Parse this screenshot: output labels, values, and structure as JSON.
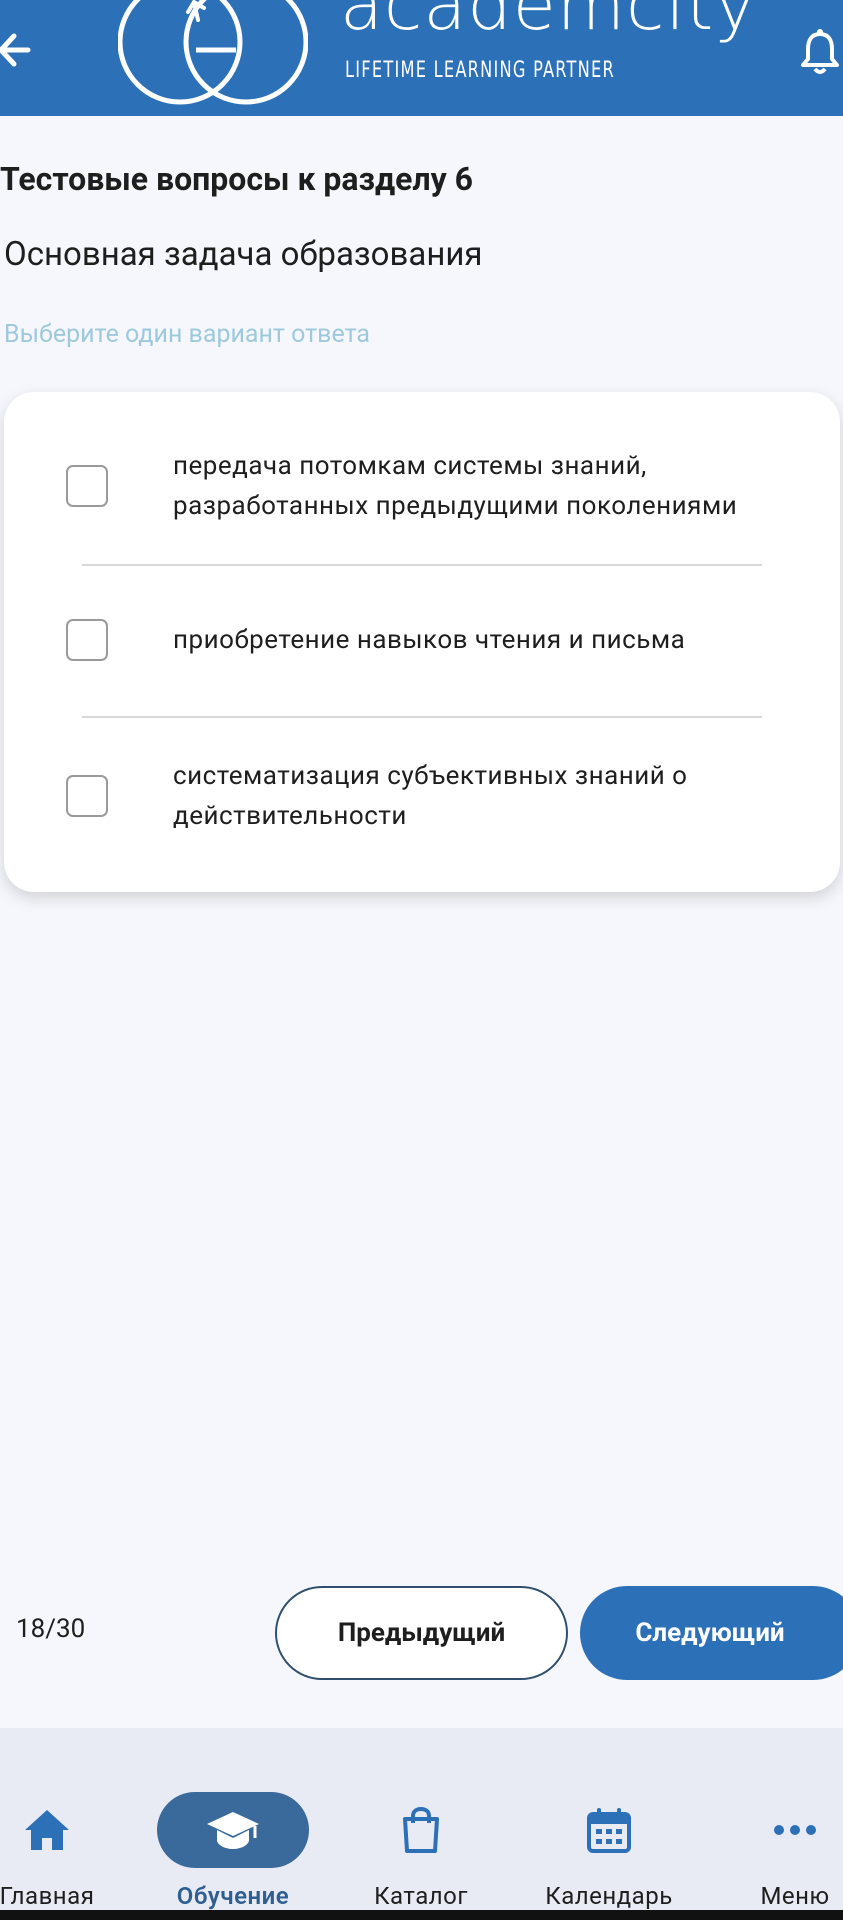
{
  "header": {
    "brand_name": "academcity",
    "brand_tagline": "LIFETIME LEARNING PARTNER"
  },
  "section_title": "Тестовые вопросы к разделу 6",
  "question": "Основная задача образования",
  "hint": "Выберите один вариант ответа",
  "options": [
    {
      "label": "передача потомкам системы знаний, разработанных предыдущими поколениями",
      "checked": false
    },
    {
      "label": "приобретение навыков чтения и письма",
      "checked": false
    },
    {
      "label": "систематизация субъективных знаний о действительности",
      "checked": false
    }
  ],
  "pagination": {
    "counter": "18/30",
    "prev_label": "Предыдущий",
    "next_label": "Следующий"
  },
  "bottom_nav": {
    "items": [
      {
        "label": "Главная",
        "icon": "home-icon"
      },
      {
        "label": "Обучение",
        "icon": "graduation-cap-icon",
        "active": true
      },
      {
        "label": "Каталог",
        "icon": "shopping-bag-icon"
      },
      {
        "label": "Календарь",
        "icon": "calendar-icon"
      },
      {
        "label": "Меню",
        "icon": "more-dots-icon"
      }
    ]
  },
  "colors": {
    "primary": "#2c70b8",
    "background": "#f5f7fc",
    "hint": "#9ec9dd",
    "nav_background": "#e8ebf4",
    "active_nav_pill": "#3a6a9c"
  }
}
